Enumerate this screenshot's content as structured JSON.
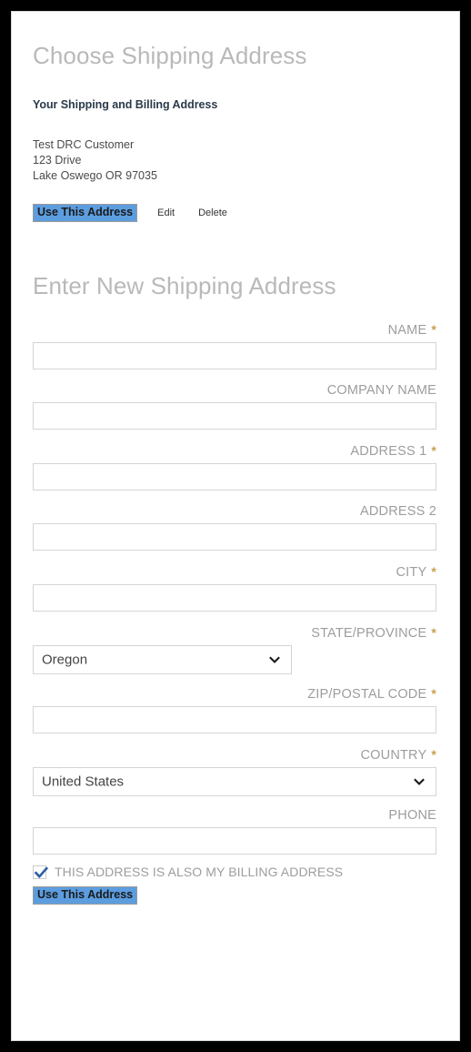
{
  "choose_section": {
    "heading": "Choose Shipping Address",
    "sub_heading": "Your Shipping and Billing Address",
    "saved_address": {
      "name": "Test DRC Customer",
      "street": "123 Drive",
      "city_state_zip": "Lake Oswego OR 97035"
    },
    "actions": {
      "use_this_address": "Use This Address",
      "edit": "Edit",
      "delete": "Delete"
    }
  },
  "new_address_section": {
    "heading": "Enter New Shipping Address",
    "required_marker": "*",
    "fields": {
      "name": {
        "label": "NAME",
        "required": true,
        "value": "",
        "placeholder": ""
      },
      "company": {
        "label": "COMPANY NAME",
        "required": false,
        "value": "",
        "placeholder": ""
      },
      "address1": {
        "label": "ADDRESS 1",
        "required": true,
        "value": "",
        "placeholder": ""
      },
      "address2": {
        "label": "ADDRESS 2",
        "required": false,
        "value": "",
        "placeholder": ""
      },
      "city": {
        "label": "CITY",
        "required": true,
        "value": "",
        "placeholder": ""
      },
      "state": {
        "label": "STATE/PROVINCE",
        "required": true,
        "value": "Oregon"
      },
      "zip": {
        "label": "ZIP/POSTAL CODE",
        "required": true,
        "value": "",
        "placeholder": ""
      },
      "country": {
        "label": "COUNTRY",
        "required": true,
        "value": "United States"
      },
      "phone": {
        "label": "PHONE",
        "required": false,
        "value": "",
        "placeholder": ""
      }
    },
    "billing_checkbox": {
      "label": "THIS ADDRESS IS ALSO MY BILLING ADDRESS",
      "checked": true
    },
    "submit_label": "Use This Address"
  },
  "colors": {
    "heading": "#b9b9b9",
    "label": "#9d9d9d",
    "required_asterisk": "#c8a050",
    "highlight_background": "#5c9ddf",
    "checkbox_check": "#2c5fa8",
    "input_border": "#d5d5d5",
    "frame": "#000000"
  },
  "icons": {
    "select_caret": "chevron-down-icon",
    "checkmark": "check-icon"
  }
}
